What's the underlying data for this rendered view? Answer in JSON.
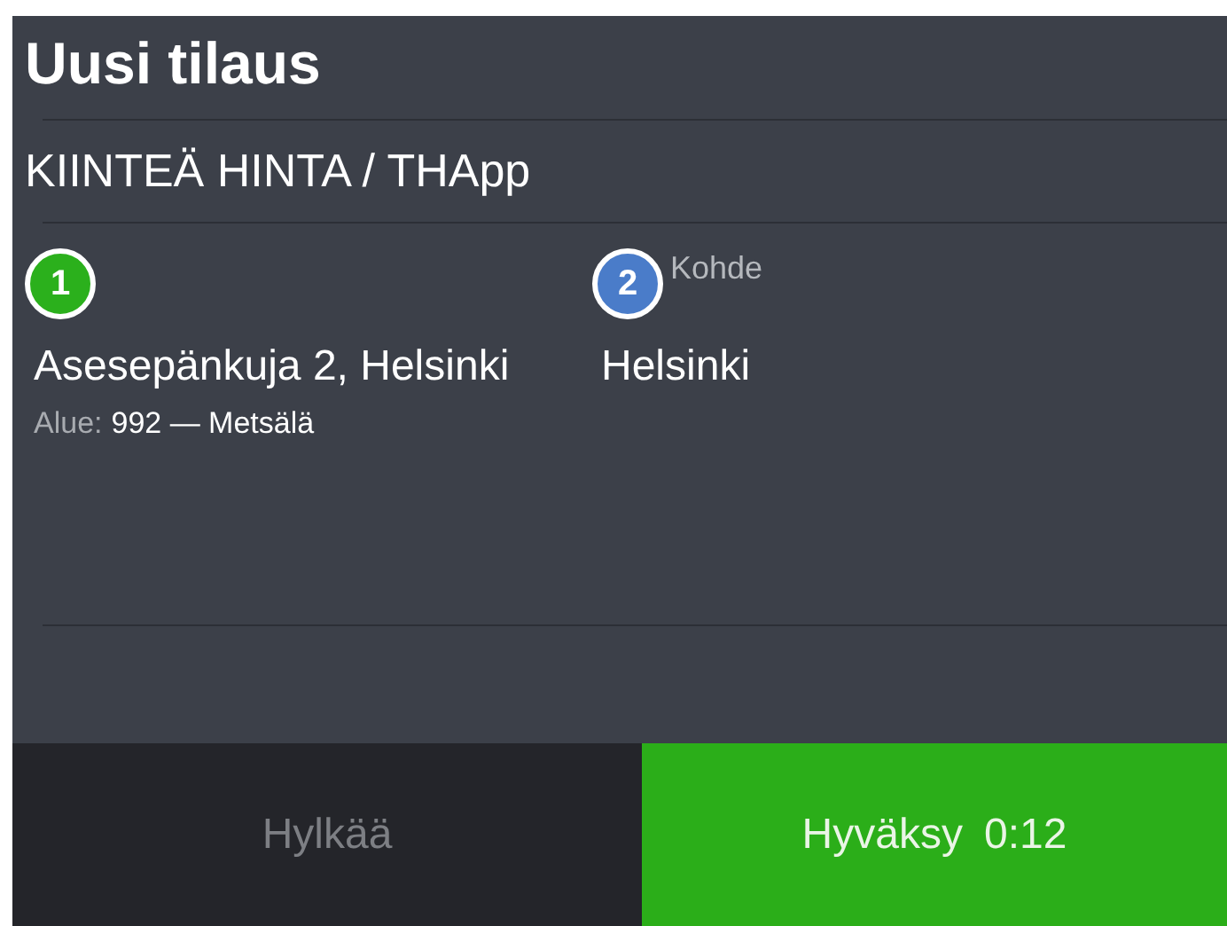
{
  "title": "Uusi tilaus",
  "subtitle": "KIINTEÄ HINTA / THApp",
  "stops": [
    {
      "number": "1",
      "color": "#2bb01c",
      "address": "Asesepänkuja 2, Helsinki",
      "area_label": "Alue:",
      "area_value": "992 — Metsälä"
    },
    {
      "number": "2",
      "color": "#4a7cc9",
      "label": "Kohde",
      "address": "Helsinki"
    }
  ],
  "buttons": {
    "reject": "Hylkää",
    "accept": "Hyväksy",
    "timer": "0:12"
  }
}
